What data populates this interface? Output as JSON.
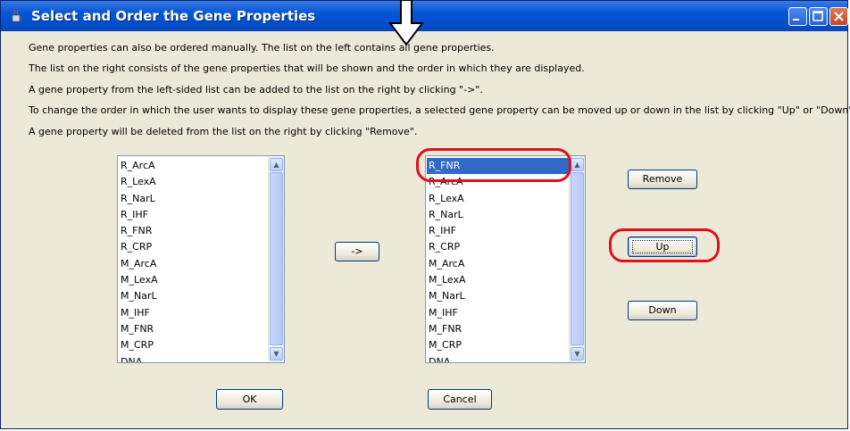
{
  "window": {
    "title": "Select and Order the Gene Properties",
    "icon": "java-cup-icon"
  },
  "instructions": [
    "Gene properties can also be ordered manually. The list on the left contains all gene properties.",
    "The list on the right consists of the gene properties that will be shown and the order in which they are displayed.",
    "A gene property from the left-sided list can be added to the list on the right by clicking \"->\".",
    "To change the order in which the user wants to display these gene properties, a selected gene property can be moved up or down in the list by clicking \"Up\" or \"Down\".",
    "A gene property will be deleted from the list on the right by clicking \"Remove\"."
  ],
  "left_list": {
    "items": [
      "R_ArcA",
      "R_LexA",
      "R_NarL",
      "R_IHF",
      "R_FNR",
      "R_CRP",
      "M_ArcA",
      "M_LexA",
      "M_NarL",
      "M_IHF",
      "M_FNR",
      "M_CRP",
      "DNA"
    ]
  },
  "right_list": {
    "items": [
      "R_FNR",
      "R_ArcA",
      "R_LexA",
      "R_NarL",
      "R_IHF",
      "R_CRP",
      "M_ArcA",
      "M_LexA",
      "M_NarL",
      "M_IHF",
      "M_FNR",
      "M_CRP",
      "DNA"
    ],
    "selected_item": "R_FNR"
  },
  "buttons": {
    "add": "->",
    "remove": "Remove",
    "up": "Up",
    "down": "Down",
    "ok": "OK",
    "cancel": "Cancel"
  },
  "annotation_color": "#e0101a"
}
